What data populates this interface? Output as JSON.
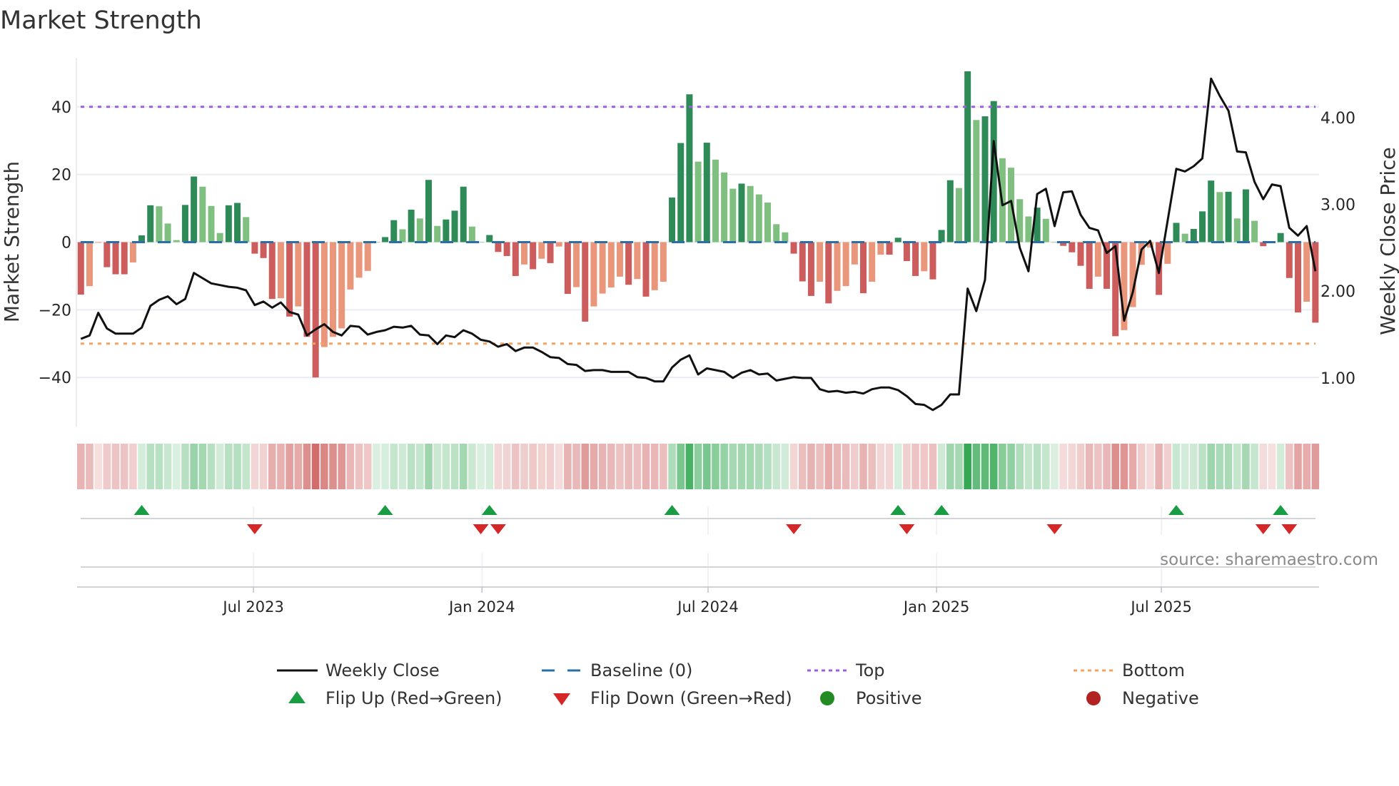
{
  "title": "Market Strength",
  "source": "source: sharemaestro.com",
  "colors": {
    "strong_green": "#2e8b57",
    "weak_green": "#7fbf7f",
    "strong_red": "#cd5c5c",
    "weak_red": "#e9967a",
    "top_line": "#9b5fe0",
    "bottom_line": "#f4a460",
    "baseline": "#2a6fa6",
    "close_line": "#111111",
    "flip_up": "#1a9c44",
    "flip_down": "#d62728",
    "positive": "#228b22",
    "negative": "#b22222",
    "strip_green": "#34a853",
    "strip_red": "#c9514f",
    "grid": "#e9ecf1"
  },
  "chart_data": {
    "type": "bar",
    "title": "Market Strength",
    "x_start": "2023-02-12",
    "x_step_days": 7,
    "x_ticks": [
      {
        "label": "Jul 2023",
        "date": "2023-07-01"
      },
      {
        "label": "Jan 2024",
        "date": "2024-01-01"
      },
      {
        "label": "Jul 2024",
        "date": "2024-07-01"
      },
      {
        "label": "Jan 2025",
        "date": "2025-01-01"
      },
      {
        "label": "Jul 2025",
        "date": "2025-07-01"
      }
    ],
    "y_left": {
      "label": "Market Strength",
      "ticks": [
        -40,
        -20,
        0,
        20,
        40
      ],
      "tick_labels": [
        "−40",
        "−20",
        "0",
        "20",
        "40"
      ],
      "range": [
        -54.5,
        54.5
      ]
    },
    "y_right": {
      "label": "Weekly Close Price",
      "ticks": [
        1,
        2,
        3,
        4
      ],
      "tick_labels": [
        "1.00",
        "2.00",
        "3.00",
        "4.00"
      ],
      "range": [
        0.44,
        4.69
      ]
    },
    "top_level": 40,
    "bottom_level": -30,
    "baseline_level": 0,
    "strength": [
      -15.5,
      -13,
      -0.2,
      -7.4,
      -9.5,
      -9.5,
      -6,
      2,
      10.9,
      10.6,
      5.5,
      0.6,
      11,
      19.4,
      16.4,
      10.7,
      2.7,
      10.9,
      11.6,
      7.4,
      -3.4,
      -4.7,
      -16.8,
      -16.6,
      -22,
      -19,
      -28,
      -40,
      -31,
      -28,
      -25.5,
      -14,
      -10.5,
      -8.5,
      0,
      1.5,
      6.5,
      3.8,
      9.6,
      7,
      18.4,
      4.8,
      6.7,
      9.3,
      16.4,
      4.6,
      0,
      2.1,
      -2.9,
      -4.1,
      -10,
      -6.6,
      -8,
      -4.9,
      -6.2,
      -1.3,
      -15.3,
      -13.3,
      -23.5,
      -19,
      -15.2,
      -13.4,
      -10.2,
      -12.6,
      -10.9,
      -16.1,
      -14.2,
      -11.7,
      13.2,
      29.3,
      43.7,
      23.8,
      29.4,
      24.4,
      20.6,
      15.8,
      17.3,
      16.6,
      14.1,
      11.7,
      5.3,
      2.9,
      -3.4,
      -11.6,
      -15.9,
      -11.7,
      -18.1,
      -14.4,
      -13,
      -6.6,
      -15.1,
      -11.7,
      -3.7,
      -3.7,
      1.3,
      -5.6,
      -10,
      -8.6,
      -11,
      3.6,
      18.3,
      16,
      50.5,
      36.1,
      37.2,
      41.7,
      24.8,
      22,
      12.7,
      7.6,
      10.2,
      6.9,
      0,
      -1.1,
      -3,
      -7,
      -13.8,
      -10.2,
      -13.8,
      -27.8,
      -26,
      -19.2,
      -6.7,
      -1.6,
      -15.6,
      -6.4,
      5.7,
      2.5,
      3.9,
      9.1,
      18.2,
      14.8,
      14.9,
      7,
      15.6,
      6.3,
      -1.2,
      -0.3,
      2.7,
      -10.6,
      -20.8,
      -17.6,
      -23.8
    ],
    "strength_shade": [
      "d",
      "l",
      "l",
      "d",
      "d",
      "d",
      "l",
      "d",
      "d",
      "l",
      "l",
      "l",
      "d",
      "d",
      "l",
      "l",
      "l",
      "d",
      "d",
      "l",
      "d",
      "d",
      "d",
      "l",
      "d",
      "l",
      "d",
      "d",
      "l",
      "l",
      "l",
      "l",
      "l",
      "l",
      "l",
      "d",
      "d",
      "l",
      "d",
      "l",
      "d",
      "l",
      "d",
      "d",
      "d",
      "l",
      "l",
      "d",
      "d",
      "d",
      "d",
      "l",
      "d",
      "l",
      "d",
      "l",
      "d",
      "l",
      "d",
      "l",
      "l",
      "l",
      "l",
      "d",
      "l",
      "d",
      "l",
      "l",
      "d",
      "d",
      "d",
      "l",
      "d",
      "l",
      "l",
      "l",
      "d",
      "l",
      "l",
      "l",
      "l",
      "l",
      "d",
      "d",
      "d",
      "l",
      "d",
      "l",
      "l",
      "l",
      "d",
      "l",
      "l",
      "d",
      "d",
      "d",
      "d",
      "l",
      "d",
      "d",
      "d",
      "l",
      "d",
      "l",
      "d",
      "d",
      "l",
      "l",
      "l",
      "l",
      "d",
      "l",
      "l",
      "d",
      "d",
      "d",
      "d",
      "l",
      "d",
      "d",
      "l",
      "l",
      "l",
      "l",
      "d",
      "l",
      "d",
      "l",
      "d",
      "d",
      "d",
      "l",
      "d",
      "l",
      "d",
      "l",
      "d",
      "l",
      "d",
      "d",
      "d",
      "l",
      "d"
    ],
    "weekly_close": [
      1.45,
      1.49,
      1.75,
      1.57,
      1.51,
      1.51,
      1.51,
      1.58,
      1.83,
      1.9,
      1.94,
      1.85,
      1.91,
      2.21,
      2.15,
      2.09,
      2.07,
      2.05,
      2.04,
      2.01,
      1.84,
      1.88,
      1.81,
      1.87,
      1.76,
      1.73,
      1.49,
      1.56,
      1.62,
      1.53,
      1.49,
      1.6,
      1.59,
      1.5,
      1.53,
      1.55,
      1.59,
      1.58,
      1.6,
      1.5,
      1.49,
      1.39,
      1.49,
      1.47,
      1.55,
      1.51,
      1.44,
      1.42,
      1.36,
      1.39,
      1.31,
      1.35,
      1.35,
      1.3,
      1.24,
      1.23,
      1.16,
      1.15,
      1.08,
      1.09,
      1.09,
      1.07,
      1.07,
      1.07,
      1.01,
      1.0,
      0.96,
      0.96,
      1.12,
      1.21,
      1.26,
      1.04,
      1.11,
      1.09,
      1.07,
      1.0,
      1.06,
      1.09,
      1.04,
      1.05,
      0.97,
      0.99,
      1.01,
      1.0,
      1.0,
      0.87,
      0.84,
      0.85,
      0.83,
      0.84,
      0.82,
      0.87,
      0.89,
      0.89,
      0.86,
      0.79,
      0.7,
      0.69,
      0.63,
      0.69,
      0.81,
      0.81,
      2.03,
      1.77,
      2.13,
      3.73,
      2.99,
      3.04,
      2.5,
      2.23,
      3.12,
      3.18,
      2.75,
      3.14,
      3.15,
      2.88,
      2.73,
      2.7,
      2.44,
      2.52,
      1.66,
      1.99,
      2.48,
      2.58,
      2.21,
      2.81,
      3.41,
      3.38,
      3.44,
      3.53,
      4.45,
      4.25,
      4.08,
      3.61,
      3.6,
      3.26,
      3.06,
      3.23,
      3.21,
      2.73,
      2.64,
      2.75,
      2.23
    ],
    "flip_up_weeks": [
      8,
      36,
      48,
      69,
      95,
      100,
      127,
      139
    ],
    "flip_down_weeks": [
      21,
      47,
      49,
      83,
      96,
      113,
      137,
      140
    ],
    "legend": [
      {
        "label": "Weekly Close",
        "kind": "line"
      },
      {
        "label": "Baseline (0)",
        "kind": "dashed"
      },
      {
        "label": "Top",
        "kind": "dotted-top"
      },
      {
        "label": "Bottom",
        "kind": "dotted-bottom"
      },
      {
        "label": "Flip Up (Red→Green)",
        "kind": "triangle-up"
      },
      {
        "label": "Flip Down (Green→Red)",
        "kind": "triangle-down"
      },
      {
        "label": "Positive",
        "kind": "circle-positive"
      },
      {
        "label": "Negative",
        "kind": "circle-negative"
      }
    ],
    "legend_position": "bottom-center"
  }
}
